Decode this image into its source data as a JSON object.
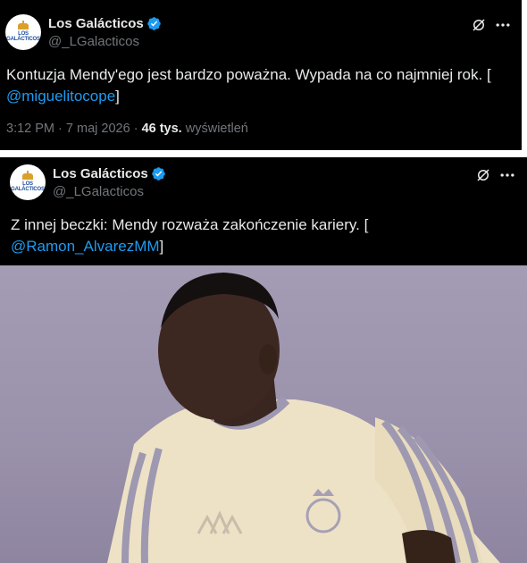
{
  "tweet1": {
    "author_name": "Los Galácticos",
    "author_handle": "@_LGalacticos",
    "avatar_lines": [
      "LOS",
      "GALÁCTICOS"
    ],
    "text_prefix": "Kontuzja Mendy'ego jest bardzo poważna. Wypada na co najmniej rok. [",
    "mention": "@miguelitocope",
    "text_suffix": "]",
    "time": "3:12 PM",
    "date": "7 maj 2026",
    "views_count": "46 tys.",
    "views_label": "wyświetleń",
    "separator": "·"
  },
  "tweet2": {
    "author_name": "Los Galácticos",
    "author_handle": "@_LGalacticos",
    "avatar_lines": [
      "LOS",
      "GALÁCTICOS"
    ],
    "text_prefix": "Z innej beczki: Mendy rozważa zakończenie kariery. [",
    "mention": "@Ramon_AlvarezMM",
    "text_suffix": "]"
  },
  "icons": {
    "verified": "verified-badge-icon",
    "grok": "grok-icon",
    "more": "more-options-icon"
  },
  "colors": {
    "background": "#000000",
    "primary_text": "#e7e9ea",
    "secondary_text": "#71767b",
    "accent": "#1d9bf0"
  }
}
